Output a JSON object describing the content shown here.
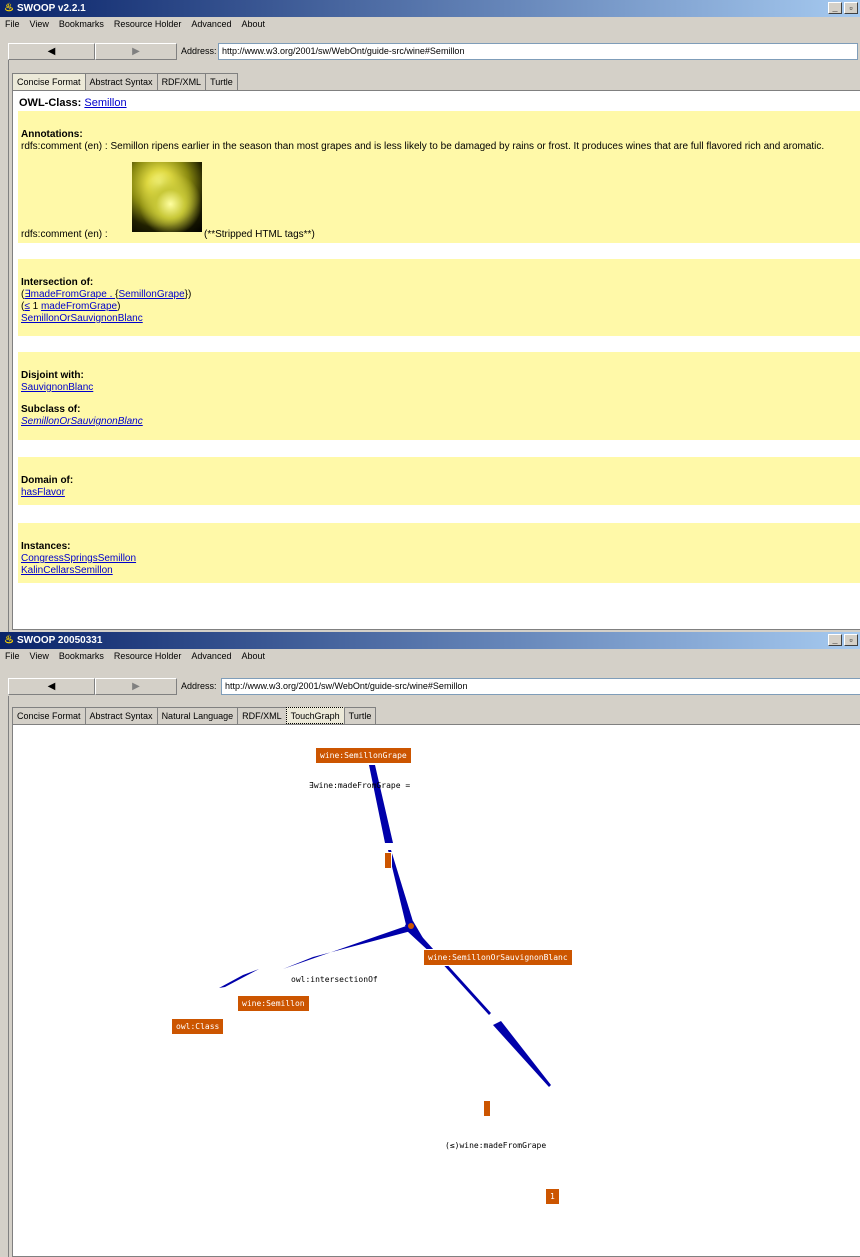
{
  "window1": {
    "title": "SWOOP v2.2.1",
    "menu": [
      "File",
      "View",
      "Bookmarks",
      "Resource Holder",
      "Advanced",
      "About"
    ],
    "back_label": "◀",
    "forward_label": "▶",
    "address_label": "Address:",
    "address_value": "http://www.w3.org/2001/sw/WebOnt/guide-src/wine#Semillon",
    "tabs": [
      "Concise Format",
      "Abstract Syntax",
      "RDF/XML",
      "Turtle"
    ],
    "header_prefix": "OWL-Class:",
    "header_class": "Semillon",
    "annotations_title": "Annotations",
    "comment1_prefix": "rdfs:comment (en) :",
    "comment1_text": "Semillon ripens earlier in the season than most grapes and is less likely to be damaged by rains or frost. It produces wines that are full flavored rich and aromatic.",
    "comment2_prefix": "rdfs:comment (en) :",
    "comment2_suffix": "(**Stripped HTML tags**)",
    "intersection_title": "Intersection of:",
    "intersection_line1_open": "(",
    "intersection_line1_link1": "∃madeFromGrape . ",
    "intersection_line1_mid": "{",
    "intersection_line1_link2": "SemillonGrape",
    "intersection_line1_close": "})",
    "intersection_line2_open": "(",
    "intersection_line2_le": "≤",
    "intersection_line2_num": " 1 ",
    "intersection_line2_link": "madeFromGrape",
    "intersection_line2_close": ")",
    "intersection_line3": "SemillonOrSauvignonBlanc",
    "disjoint_title": "Disjoint with:",
    "disjoint_item": "SauvignonBlanc",
    "subclass_title": "Subclass of:",
    "subclass_item": "SemillonOrSauvignonBlanc",
    "domain_title": "Domain of:",
    "domain_item": "hasFlavor",
    "instances_title": "Instances:",
    "instances": [
      "CongressSpringsSemillon",
      "KalinCellarsSemillon"
    ]
  },
  "window2": {
    "title": "SWOOP 20050331",
    "menu": [
      "File",
      "View",
      "Bookmarks",
      "Resource Holder",
      "Advanced",
      "About"
    ],
    "back_label": "◀",
    "forward_label": "▶",
    "address_label": "Address:",
    "address_value": "http://www.w3.org/2001/sw/WebOnt/guide-src/wine#Semillon",
    "tabs": [
      "Concise Format",
      "Abstract Syntax",
      "Natural Language",
      "RDF/XML",
      "TouchGraph",
      "Turtle"
    ],
    "graph": {
      "nodes": {
        "semillon_grape": "wine:SemillonGrape",
        "sem_or_sauv": "wine:SemillonOrSauvignonBlanc",
        "semillon": "wine:Semillon",
        "owl_class": "owl:Class",
        "one": "1"
      },
      "edge_labels": {
        "exists_made": "∃wine:madeFromGrape =",
        "intersection": "owl:intersectionOf",
        "le_made": "(≤)wine:madeFromGrape"
      }
    }
  },
  "icons": {
    "title_icon": "swoop-icon",
    "minimize": "minimize-icon",
    "maximize": "maximize-icon",
    "close": "close-icon"
  }
}
